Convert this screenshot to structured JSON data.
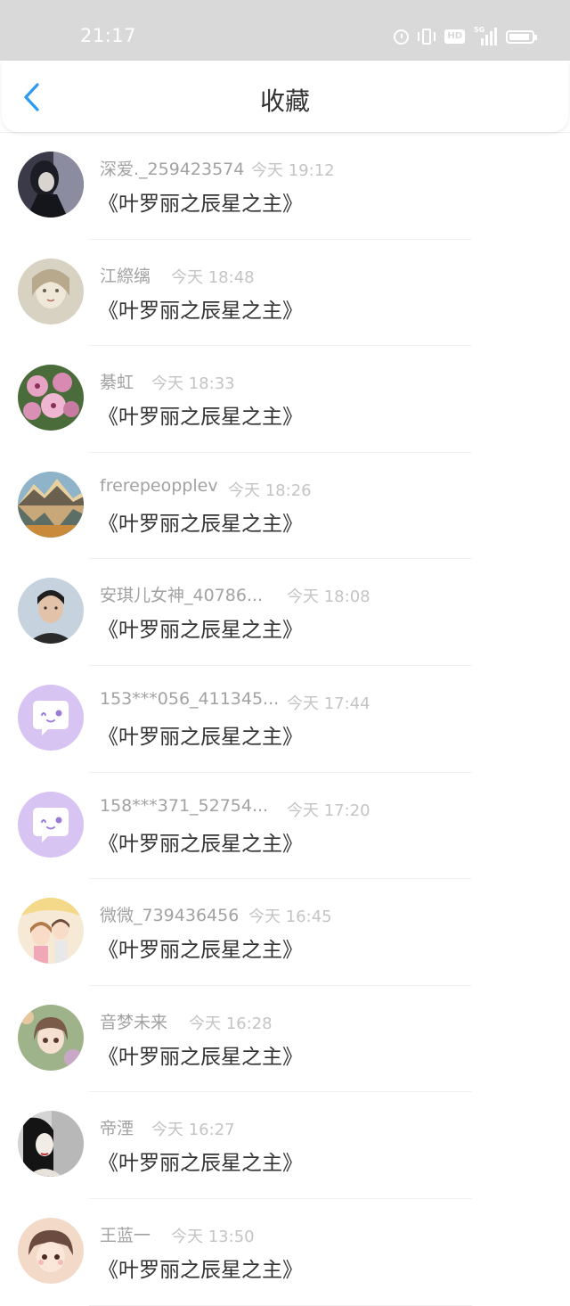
{
  "status_bar": {
    "time": "21:17",
    "icons": [
      "alarm-icon",
      "vibrate-icon",
      "hd-icon",
      "5g-signal-icon",
      "battery-icon"
    ],
    "hd_label": "HD",
    "network_label": "5G"
  },
  "header": {
    "title": "收藏",
    "back_icon": "chevron-left-icon",
    "accent_color": "#2b9af3"
  },
  "items": [
    {
      "username": "深爱._259423574",
      "time": "今天 19:12",
      "book": "《叶罗丽之辰星之主》",
      "avatar": "dark-character-avatar"
    },
    {
      "username": "江縩缡",
      "time": "今天 18:48",
      "book": "《叶罗丽之辰星之主》",
      "avatar": "sketch-girl-avatar"
    },
    {
      "username": "綦虹",
      "time": "今天 18:33",
      "book": "《叶罗丽之辰星之主》",
      "avatar": "pink-flowers-avatar"
    },
    {
      "username": "frerepeopplev",
      "time": "今天 18:26",
      "book": "《叶罗丽之辰星之主》",
      "avatar": "mountain-lake-avatar"
    },
    {
      "username": "安琪儿女神_40786...",
      "time": "今天 18:08",
      "book": "《叶罗丽之辰星之主》",
      "avatar": "person-photo-avatar"
    },
    {
      "username": "153***056_411345...",
      "time": "今天 17:44",
      "book": "《叶罗丽之辰星之主》",
      "avatar": "default-chat-avatar"
    },
    {
      "username": "158***371_52754...",
      "time": "今天 17:20",
      "book": "《叶罗丽之辰星之主》",
      "avatar": "default-chat-avatar"
    },
    {
      "username": "微微_739436456",
      "time": "今天 16:45",
      "book": "《叶罗丽之辰星之主》",
      "avatar": "anime-couple-avatar"
    },
    {
      "username": "音梦未来",
      "time": "今天 16:28",
      "book": "《叶罗丽之辰星之主》",
      "avatar": "anime-girl-avatar"
    },
    {
      "username": "帝湮",
      "time": "今天 16:27",
      "book": "《叶罗丽之辰星之主》",
      "avatar": "ink-lady-avatar"
    },
    {
      "username": "王蓝一",
      "time": "今天 13:50",
      "book": "《叶罗丽之辰星之主》",
      "avatar": "cute-girl-avatar"
    }
  ]
}
